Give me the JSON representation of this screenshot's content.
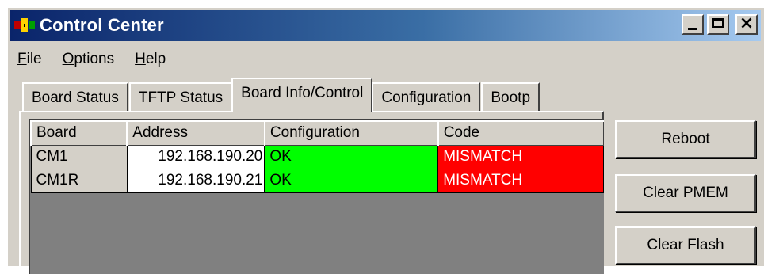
{
  "window": {
    "title": "Control Center",
    "controls": {
      "minimize": "_",
      "maximize": "□",
      "close": "×"
    }
  },
  "menu": [
    {
      "label": "File",
      "accel": "F",
      "rest": "ile"
    },
    {
      "label": "Options",
      "accel": "O",
      "rest": "ptions"
    },
    {
      "label": "Help",
      "accel": "H",
      "rest": "elp"
    }
  ],
  "tabs": [
    {
      "label": "Board Status",
      "active": false
    },
    {
      "label": "TFTP Status",
      "active": false
    },
    {
      "label": "Board Info/Control",
      "active": true
    },
    {
      "label": "Configuration",
      "active": false
    },
    {
      "label": "Bootp",
      "active": false
    }
  ],
  "table": {
    "columns": [
      "Board",
      "Address",
      "Configuration",
      "Code"
    ],
    "rows": [
      {
        "board": "CM1",
        "address": "192.168.190.20",
        "configuration": "OK",
        "code": "MISMATCH"
      },
      {
        "board": "CM1R",
        "address": "192.168.190.21",
        "configuration": "OK",
        "code": "MISMATCH"
      }
    ]
  },
  "buttons": {
    "reboot": "Reboot",
    "clear_pmem": "Clear PMEM",
    "clear_flash": "Clear Flash"
  },
  "colors": {
    "ok": "#00ff00",
    "mismatch": "#ff0000",
    "grid_background": "#808080",
    "title_gradient_start": "#0a246a"
  }
}
